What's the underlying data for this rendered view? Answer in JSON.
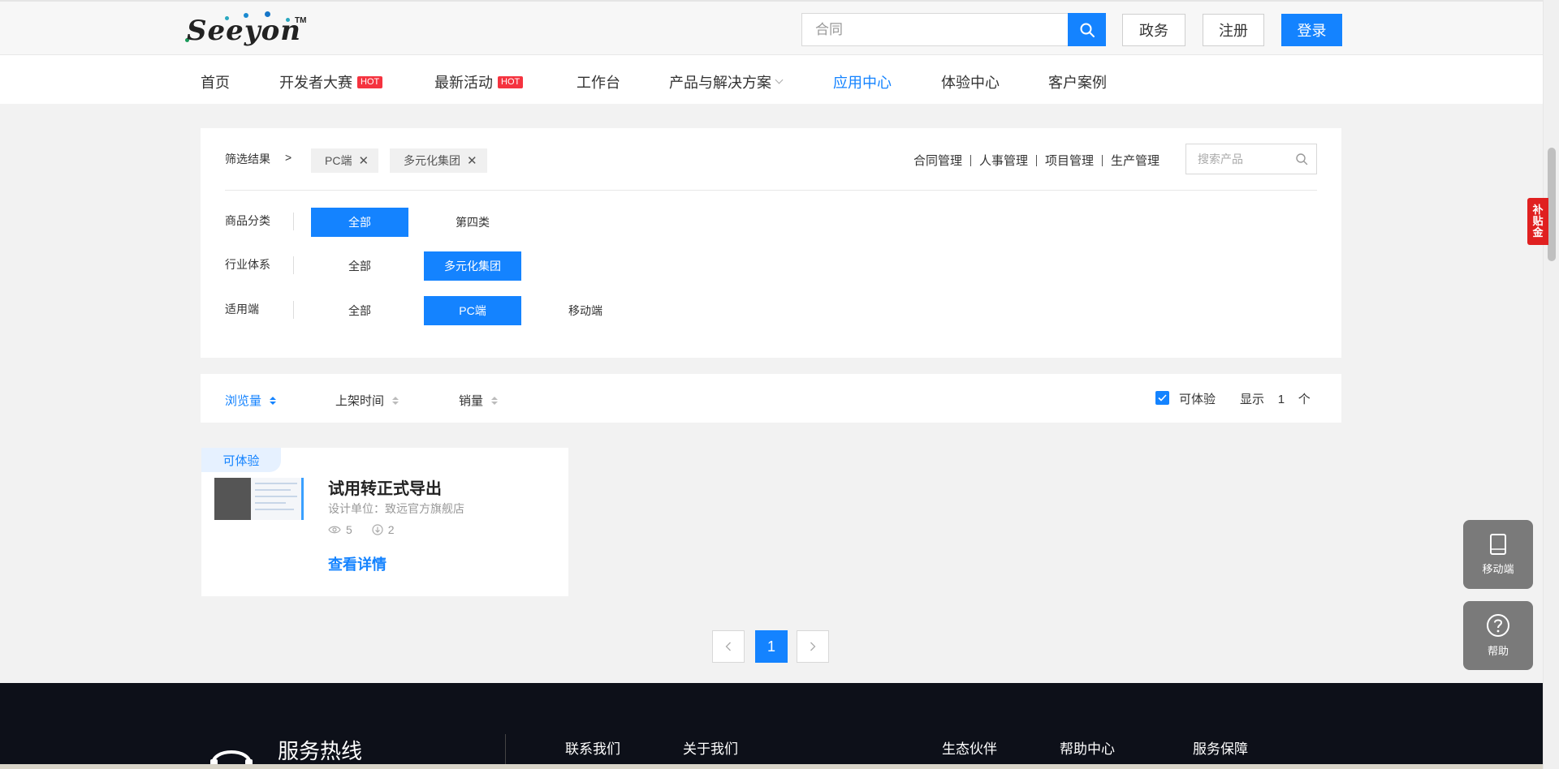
{
  "header": {
    "logo_text": "Seeyon",
    "logo_tm": "TM",
    "search_placeholder": "合同",
    "gov_label": "政务",
    "register_label": "注册",
    "login_label": "登录"
  },
  "nav": {
    "items": [
      {
        "label": "首页"
      },
      {
        "label": "开发者大赛",
        "badge": "HOT"
      },
      {
        "label": "最新活动",
        "badge": "HOT"
      },
      {
        "label": "工作台"
      },
      {
        "label": "产品与解决方案"
      },
      {
        "label": "应用中心",
        "active": true
      },
      {
        "label": "体验中心"
      },
      {
        "label": "客户案例"
      }
    ]
  },
  "filter": {
    "result_label": "筛选结果",
    "result_sep": ">",
    "chips": [
      "PC端",
      "多元化集团"
    ],
    "quick_links": [
      "合同管理",
      "人事管理",
      "项目管理",
      "生产管理"
    ],
    "product_search_placeholder": "搜索产品",
    "rows": [
      {
        "label": "商品分类",
        "options": [
          "全部",
          "第四类"
        ],
        "selected": 0
      },
      {
        "label": "行业体系",
        "options": [
          "全部",
          "多元化集团"
        ],
        "selected": 1
      },
      {
        "label": "适用端",
        "options": [
          "全部",
          "PC端",
          "移动端"
        ],
        "selected": 1
      }
    ]
  },
  "sort": {
    "items": [
      "浏览量",
      "上架时间",
      "销量"
    ],
    "active_index": 0,
    "experience_label": "可体验",
    "experience_checked": true,
    "show_label": "显示",
    "count": "1",
    "unit": "个"
  },
  "products": [
    {
      "tag": "可体验",
      "title": "试用转正式导出",
      "designer_label": "设计单位：",
      "designer": "致远官方旗舰店",
      "views": "5",
      "downloads": "2",
      "link": "查看详情"
    }
  ],
  "pagination": {
    "current": "1"
  },
  "footer": {
    "hotline": "服务热线",
    "links": [
      "联系我们",
      "关于我们",
      "生态伙伴",
      "帮助中心",
      "服务保障"
    ]
  },
  "side": {
    "subsidy": [
      "补",
      "贴",
      "金"
    ],
    "mobile_label": "移动端",
    "help_label": "帮助"
  },
  "colors": {
    "accent": "#1483ff",
    "hot": "#f5333f",
    "footer_bg": "#0d1019"
  }
}
